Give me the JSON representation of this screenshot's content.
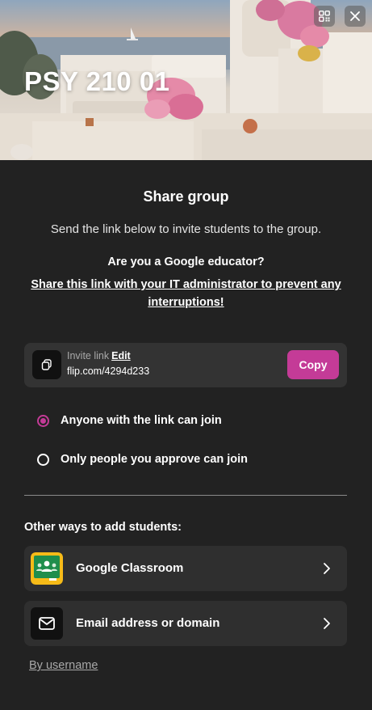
{
  "hero": {
    "group_name": "PSY 210 01",
    "qr_icon": "qr-code-icon",
    "close_icon": "close-icon"
  },
  "share": {
    "title": "Share group",
    "subtitle": "Send the link below to invite students to the group.",
    "google_question": "Are you a Google educator?",
    "google_link": "Share this link with your IT administrator to prevent any interruptions!"
  },
  "invite": {
    "label": "Invite link",
    "edit_label": "Edit",
    "url": "flip.com/4294d233",
    "copy_label": "Copy",
    "icon": "copy-icon"
  },
  "join_options": [
    {
      "label": "Anyone with the link can join",
      "selected": true
    },
    {
      "label": "Only people you approve can join",
      "selected": false
    }
  ],
  "other_ways": {
    "heading": "Other ways to add students:",
    "items": [
      {
        "label": "Google Classroom",
        "icon": "google-classroom-icon"
      },
      {
        "label": "Email address or domain",
        "icon": "mail-icon"
      }
    ],
    "by_username": "By username"
  },
  "colors": {
    "accent": "#c43b97",
    "background": "#222222",
    "card": "#2f2f2f"
  }
}
